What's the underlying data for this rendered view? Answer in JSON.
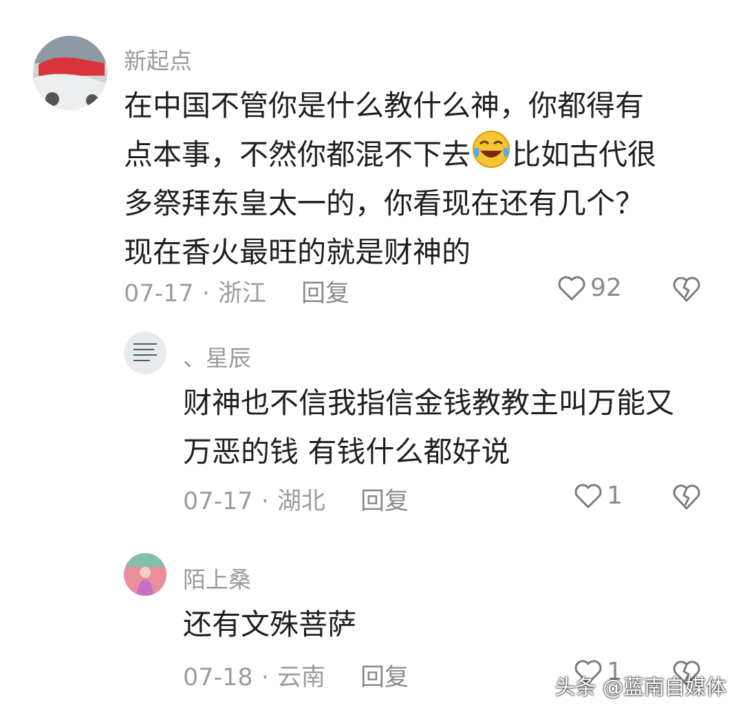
{
  "colors": {
    "username": "#9a9a9a",
    "content": "#1f1f1f",
    "meta": "#9c9c9c"
  },
  "comments": [
    {
      "username": "新起点",
      "avatar_icon": "car-photo-avatar-icon",
      "lines": [
        "在中国不管你是什么教什么神，你都得有",
        "点本事，不然你都混不下去",
        "比如古代很",
        "多祭拜东皇太一的，你看现在还有几个？",
        "现在香火最旺的就是财神的"
      ],
      "emoji_icon": "laughing-tears-emoji-icon",
      "date": "07-17",
      "location": "浙江",
      "reply_label": "回复",
      "likes": "92"
    },
    {
      "username": "、星辰",
      "avatar_icon": "handwritten-note-avatar-icon",
      "lines": [
        "财神也不信我指信金钱教教主叫万能又",
        "万恶的钱 有钱什么都好说"
      ],
      "date": "07-17",
      "location": "湖北",
      "reply_label": "回复",
      "likes": "1"
    },
    {
      "username": "陌上桑",
      "avatar_icon": "person-photo-avatar-icon",
      "lines": [
        "还有文殊菩萨"
      ],
      "date": "07-18",
      "location": "云南",
      "reply_label": "回复",
      "likes": "1"
    }
  ],
  "separator": "·",
  "watermark": "头条 @蓝南自媒体"
}
